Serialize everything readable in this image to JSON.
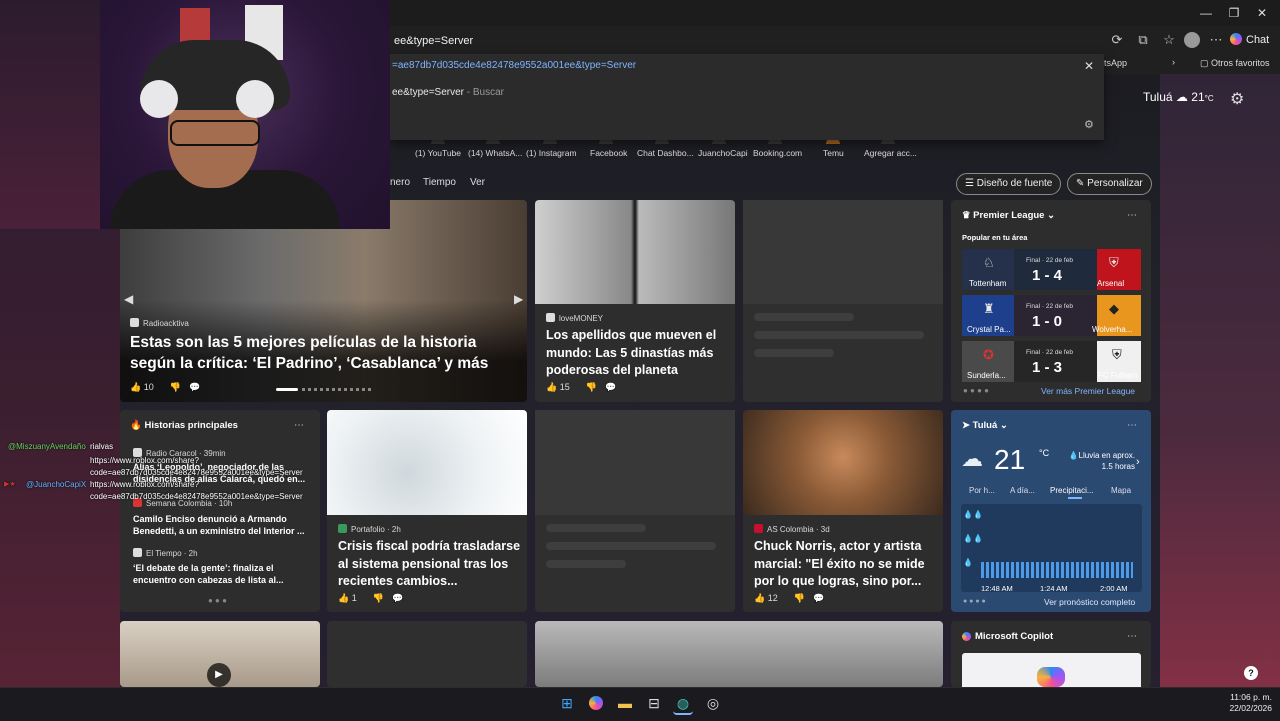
{
  "browser": {
    "address_value": "ee&type=Server",
    "suggestion_1": "=ae87db7d035cde4e82478e9552a001ee&type=Server",
    "suggestion_2": "ee&type=Server",
    "suggestion_2_hint": " - Buscar",
    "chat_label": "Chat",
    "favbar_item": "tsApp",
    "other_favorites": "Otros favoritos",
    "favorites": [
      "(1) YouTube",
      "(14) WhatsA...",
      "(1) Instagram",
      "Facebook",
      "Chat Dashbo...",
      "JuanchoCapi",
      "Booking.com",
      "Temu",
      "Agregar acc..."
    ]
  },
  "header": {
    "city": "Tuluá",
    "temp": "21",
    "unit": "°C",
    "nav": [
      "nero",
      "Tiempo",
      "Ver"
    ],
    "font_design": "Diseño de fuente",
    "personalize": "Personalizar"
  },
  "hero": {
    "source": "Radioacktiva",
    "title": "Estas son las 5 mejores películas de la historia según la crítica: ‘El Padrino’, ‘Casablanca’ y más",
    "likes": "10"
  },
  "card_lovemoney": {
    "source": "loveMONEY",
    "title": "Los apellidos que mueven el mundo: Las 5 dinastías más poderosas del planeta",
    "likes": "15"
  },
  "premier": {
    "title": "Premier League",
    "subtitle": "Popular en tu área",
    "matches": [
      {
        "final": "Final · 22 de feb",
        "home": "Tottenham",
        "away": "Arsenal",
        "score": "1 - 4"
      },
      {
        "final": "Final · 22 de feb",
        "home": "Crystal Pa...",
        "away": "Wolverha...",
        "score": "1 - 0"
      },
      {
        "final": "Final · 22 de feb",
        "home": "Sunderla...",
        "away": "FC Fulham",
        "score": "1 - 3"
      }
    ],
    "more": "Ver más Premier League"
  },
  "top_stories": {
    "title": "Historias principales",
    "items": [
      {
        "source": "Radio Caracol · 39min",
        "title": "Alias ‘Leopoldo’, negociador de las disidencias de alias Calarcá, quedó en..."
      },
      {
        "source": "Semana Colombia · 10h",
        "title": "Camilo Enciso denunció a Armando Benedetti, a un exministro del Interior ..."
      },
      {
        "source": "El Tiempo · 2h",
        "title": "‘El debate de la gente’: finaliza el encuentro con cabezas de lista al..."
      }
    ]
  },
  "card_portafolio": {
    "source": "Portafolio · 2h",
    "title": "Crisis fiscal podría trasladarse al sistema pensional tras los recientes cambios...",
    "likes": "1"
  },
  "card_chuck": {
    "source": "AS Colombia · 3d",
    "title": "Chuck Norris, actor y artista marcial: \"El éxito no se mide por lo que logras, sino por...",
    "likes": "12"
  },
  "weather": {
    "city": "Tuluá",
    "temp": "21",
    "unit": "°C",
    "rain_note": "Lluvia en aprox. 1.5 horas",
    "tabs": [
      "Por h...",
      "A día...",
      "Precipitaci...",
      "Mapa"
    ],
    "times": [
      "12:48 AM",
      "1:24 AM",
      "2:00 AM"
    ],
    "forecast": "Ver pronóstico completo"
  },
  "copilot": {
    "title": "Microsoft Copilot"
  },
  "chat_overlay": {
    "user1": "@MiszuanyAvendaño",
    "msg1": "rialvas",
    "url1a": "https://www.roblox.com/share?",
    "url1b": "code=ae87db7d035cde4e82478e9552a001ee&type=Server",
    "user2": "@JuanchoCapiX",
    "url2a": "https://www.roblox.com/share?",
    "url2b": "code=ae87db7d035cde4e82478e9552a001ee&type=Server"
  },
  "taskbar": {
    "time": "11:06 p. m.",
    "date": "22/02/2026"
  }
}
